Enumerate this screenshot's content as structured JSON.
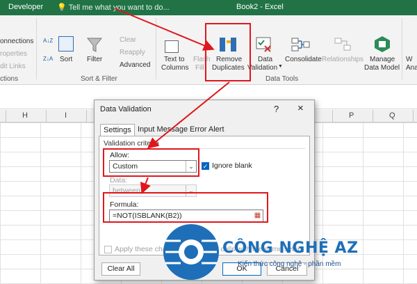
{
  "titlebar": {
    "tab": "Developer",
    "tell_me": "Tell me what you want to do...",
    "window_title": "Book2 - Excel"
  },
  "ribbon": {
    "left_partial": [
      "onnections",
      "roperties",
      "dit Links",
      "ctions"
    ],
    "sort_az": "A↓Z",
    "sort_za": "Z↓A",
    "sort": "Sort",
    "filter": "Filter",
    "clear": "Clear",
    "reapply": "Reapply",
    "advanced": "Advanced",
    "sort_filter_group": "Sort & Filter",
    "text_to_columns": [
      "Text to",
      "Columns"
    ],
    "flash_fill": [
      "Flash",
      "Fill"
    ],
    "remove_duplicates": [
      "Remove",
      "Duplicates"
    ],
    "data_validation": [
      "Data",
      "Validation"
    ],
    "consolidate": "Consolidate",
    "relationships": "Relationships",
    "manage_data_model": [
      "Manage",
      "Data Model"
    ],
    "data_tools_group": "Data Tools",
    "right_partial": [
      "W",
      "Ana"
    ]
  },
  "columns": [
    "H",
    "I",
    "P",
    "Q"
  ],
  "dialog": {
    "title": "Data Validation",
    "help": "?",
    "close": "×",
    "tabs": [
      "Settings",
      "Input Message",
      "Error Alert"
    ],
    "section": "Validation criteria",
    "allow_label": "Allow:",
    "allow_value": "Custom",
    "ignore_blank": "Ignore blank",
    "ignore_blank_checked": true,
    "data_label": "Data:",
    "data_value": "between",
    "formula_label": "Formula:",
    "formula_value": "=NOT(ISBLANK(B2))",
    "apply_text": "Apply these changes to all other cells with the same settings",
    "apply_checked": false,
    "clear_all": "Clear All",
    "ok": "OK",
    "cancel": "Cancel"
  },
  "watermark": {
    "brand": "CÔNG NGHỆ AZ",
    "slogan": "Kiến thức công nghệ - phần mềm"
  },
  "colors": {
    "excel_green": "#217346",
    "highlight_red": "#e0161c",
    "brand_blue": "#1e6fb8"
  }
}
